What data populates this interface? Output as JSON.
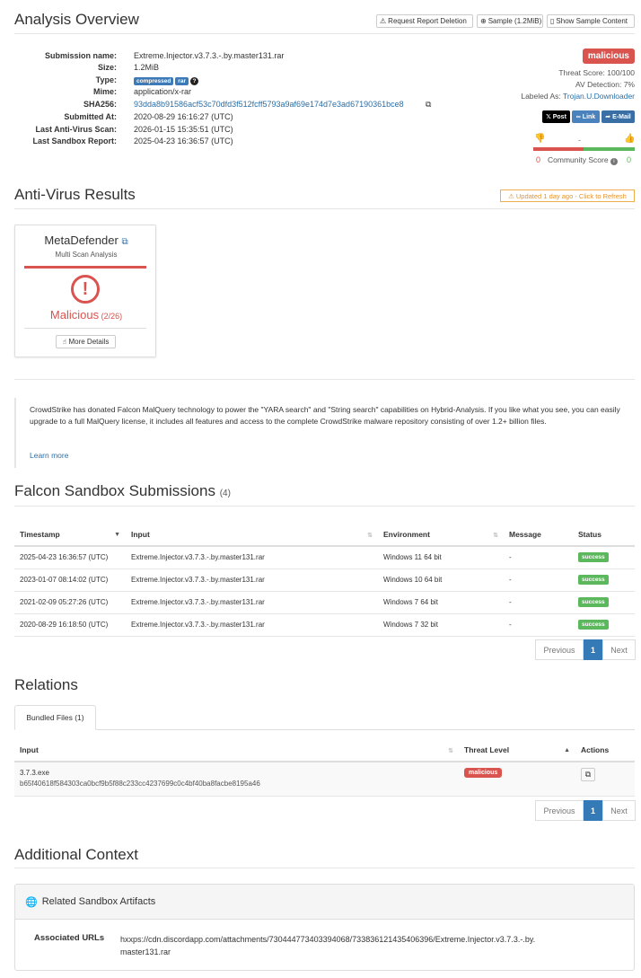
{
  "overview": {
    "title": "Analysis Overview",
    "buttons": {
      "delete": "Request Report Deletion",
      "sample": "Sample (1.2MiB)",
      "show": "Show Sample Content"
    },
    "fields": {
      "submission_name_label": "Submission name:",
      "submission_name": "Extreme.Injector.v3.7.3.-.by.master131.rar",
      "size_label": "Size:",
      "size": "1.2MiB",
      "type_label": "Type:",
      "type_tags": [
        "compressed",
        "rar"
      ],
      "mime_label": "Mime:",
      "mime": "application/x-rar",
      "sha_label": "SHA256:",
      "sha256": "93dda8b91586acf53c70dfd3f512fcff5793a9af69e174d7e3ad67190361bce8",
      "submitted_label": "Submitted At:",
      "submitted": "2020-08-29 16:16:27 (UTC)",
      "last_av_label": "Last Anti-Virus Scan:",
      "last_av": "2026-01-15 15:35:51 (UTC)",
      "last_sandbox_label": "Last Sandbox Report:",
      "last_sandbox": "2025-04-23 16:36:57 (UTC)"
    },
    "verdict": "malicious",
    "threat_score": "Threat Score: 100/100",
    "av_detection": "AV Detection: 7%",
    "labeled_as_label": "Labeled As:",
    "labeled_as": "Trojan.U.Downloader",
    "share": {
      "post": "Post",
      "link": "Link",
      "email": "E-Mail"
    },
    "community": {
      "minus": "-",
      "down": "0",
      "label": "Community Score",
      "up": "0"
    }
  },
  "antivirus": {
    "title": "Anti-Virus Results",
    "updated": "Updated 1 day ago - Click to Refresh",
    "card": {
      "name": "MetaDefender",
      "subtitle": "Multi Scan Analysis",
      "verdict": "Malicious",
      "ratio": "(2/26)",
      "details_btn": "More Details"
    }
  },
  "notice": {
    "text": "CrowdStrike has donated Falcon MalQuery technology to power the \"YARA search\" and \"String search\" capabilities on Hybrid-Analysis. If you like what you see, you can easily upgrade to a full MalQuery license, it includes all features and access to the complete CrowdStrike malware repository consisting of over 1.2+ billion files.",
    "link": "Learn more"
  },
  "submissions": {
    "title": "Falcon Sandbox Submissions",
    "count": "(4)",
    "columns": [
      "Timestamp",
      "Input",
      "Environment",
      "Message",
      "Status"
    ],
    "rows": [
      [
        "2025-04-23 16:36:57 (UTC)",
        "Extreme.Injector.v3.7.3.-.by.master131.rar",
        "Windows 11 64 bit",
        "-",
        "success"
      ],
      [
        "2023-01-07 08:14:02 (UTC)",
        "Extreme.Injector.v3.7.3.-.by.master131.rar",
        "Windows 10 64 bit",
        "-",
        "success"
      ],
      [
        "2021-02-09 05:27:26 (UTC)",
        "Extreme.Injector.v3.7.3.-.by.master131.rar",
        "Windows 7 64 bit",
        "-",
        "success"
      ],
      [
        "2020-08-29 16:18:50 (UTC)",
        "Extreme.Injector.v3.7.3.-.by.master131.rar",
        "Windows 7 32 bit",
        "-",
        "success"
      ]
    ],
    "pager": {
      "prev": "Previous",
      "page": "1",
      "next": "Next"
    }
  },
  "relations": {
    "title": "Relations",
    "tab": "Bundled Files (1)",
    "columns": [
      "Input",
      "Threat Level",
      "Actions"
    ],
    "row": {
      "name": "3.7.3.exe",
      "hash": "b65f40618f584303ca0bcf9b5f88c233cc4237699c0c4bf40ba8facbe8195a46",
      "level": "malicious"
    },
    "pager": {
      "prev": "Previous",
      "page": "1",
      "next": "Next"
    }
  },
  "context": {
    "title": "Additional Context",
    "panel_title": "Related Sandbox Artifacts",
    "assoc_label": "Associated URLs",
    "url_line1": "hxxps://cdn.discordapp.com/attachments/730444773403394068/733836121435406396/Extreme.Injector.v3.7.3.-.by.",
    "url_line2": "master131.rar"
  },
  "colors": {
    "malicious": "#d9534f",
    "link": "#2c6ea5",
    "success": "#5cb85c",
    "warning": "#f0ad4e"
  }
}
